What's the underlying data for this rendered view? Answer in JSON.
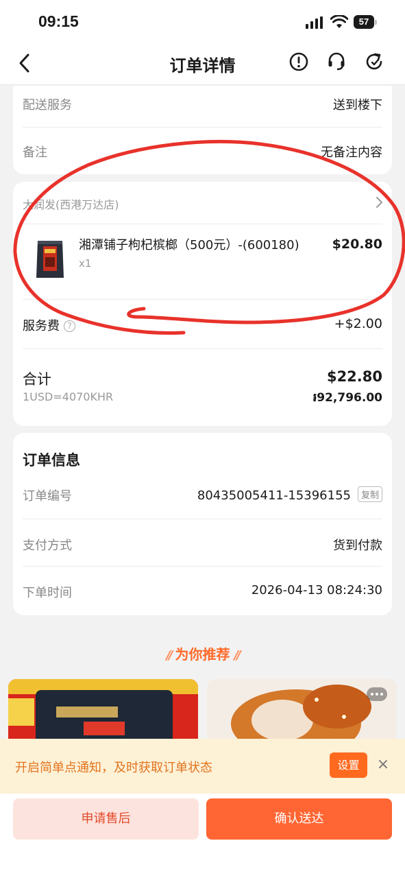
{
  "status_bar": {
    "time": "09:15",
    "battery": "57"
  },
  "nav": {
    "title": "订单详情",
    "icons": [
      "back-arrow-icon",
      "report-icon",
      "customer-service-icon",
      "refresh-icon"
    ]
  },
  "delivery_card": {
    "service_label": "配送服务",
    "service_value": "送到楼下",
    "note_label": "备注",
    "note_value": "无备注内容"
  },
  "order_card": {
    "store_name": "大润发(西港万达店)",
    "product": {
      "name": "湘潭铺子枸杞槟榔（500元）-(600180)",
      "qty": "x1",
      "price": "$20.80"
    },
    "service_fee_label": "服务费",
    "service_fee_help": "?",
    "service_fee_value": "+$2.00",
    "total_label": "合计",
    "total_usd": "$22.80",
    "exchange_rate": "1USD=4070KHR",
    "total_khr": "៛92,796.00"
  },
  "info_card": {
    "title": "订单信息",
    "order_no_label": "订单编号",
    "order_no_value": "80435005411-15396155",
    "copy_label": "复制",
    "payment_label": "支付方式",
    "payment_value": "货到付款",
    "time_label": "下单时间",
    "time_value": "2026-04-13 08:24:30"
  },
  "recommend": {
    "heading": "为你推荐",
    "deco_left": "//",
    "deco_right": "//"
  },
  "notice": {
    "text": "开启简单点通知，及时获取订单状态",
    "set_label": "设置",
    "close_label": "×"
  },
  "actions": {
    "after_sale": "申请售后",
    "confirm": "确认送达"
  },
  "colors": {
    "accent": "#ff6633",
    "notice_bg": "#fdf1d6",
    "annotation": "#e8322b"
  }
}
